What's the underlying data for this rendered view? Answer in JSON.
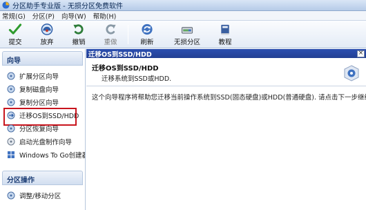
{
  "window": {
    "title": "分区助手专业版 - 无损分区免费软件"
  },
  "menu": {
    "items": [
      "常规(G)",
      "分区(P)",
      "向导(W)",
      "帮助(H)"
    ]
  },
  "toolbar": {
    "submit": "提交",
    "discard": "放弃",
    "undo": "撤销",
    "redo": "重做",
    "refresh": "刷新",
    "lossless": "无损分区",
    "tutorial": "教程"
  },
  "sidebar": {
    "wizard_header": "向导",
    "wizard_items": [
      {
        "label": "扩展分区向导",
        "icon": "extend-partition-icon"
      },
      {
        "label": "复制磁盘向导",
        "icon": "copy-disk-icon"
      },
      {
        "label": "复制分区向导",
        "icon": "copy-partition-icon"
      },
      {
        "label": "迁移OS到SSD/HDD",
        "icon": "migrate-os-icon"
      },
      {
        "label": "分区恢复向导",
        "icon": "partition-recovery-icon"
      },
      {
        "label": "启动光盘制作向导",
        "icon": "bootable-disc-icon"
      },
      {
        "label": "Windows To Go创建器",
        "icon": "windows-to-go-icon"
      }
    ],
    "ops_header": "分区操作",
    "ops_items": [
      {
        "label": "调整/移动分区",
        "icon": "resize-move-icon"
      }
    ]
  },
  "panel": {
    "title": "迁移OS到SSD/HDD",
    "banner_title": "迁移OS到SSD/HDD",
    "banner_subtitle": "迁移系统到SSD或HDD.",
    "body_text": "这个向导程序将帮助您迁移当前操作系统到SSD(固态硬盘)或HDD(普通硬盘). 请点击下一步继续.",
    "close_label": "×"
  },
  "colors": {
    "panel_header": "#2b4fb0",
    "highlight_border": "#c8141d",
    "submit_check": "#2e9b2e"
  }
}
